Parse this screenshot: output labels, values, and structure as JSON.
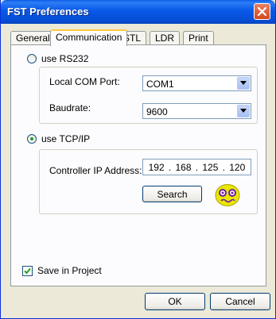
{
  "window": {
    "title": "FST Preferences"
  },
  "tabs": [
    {
      "label": "General"
    },
    {
      "label": "Communication",
      "active": true
    },
    {
      "label": "STL"
    },
    {
      "label": "LDR"
    },
    {
      "label": "Print"
    }
  ],
  "rs232": {
    "radio_label": "use RS232",
    "selected": false,
    "com_port_label": "Local COM Port:",
    "com_port_value": "COM1",
    "baudrate_label": "Baudrate:",
    "baudrate_value": "9600"
  },
  "tcpip": {
    "radio_label": "use TCP/IP",
    "selected": true,
    "ip_label": "Controller IP Address:",
    "ip": [
      "192",
      "168",
      "125",
      "120"
    ],
    "search_label": "Search",
    "status_icon": "smiley-status-icon"
  },
  "save_in_project": {
    "label": "Save in Project",
    "checked": true
  },
  "footer": {
    "ok_label": "OK",
    "cancel_label": "Cancel"
  },
  "colors": {
    "title_bar": "#0a5ce6",
    "dialog_bg": "#ece9d8",
    "smiley": "#e8e800"
  }
}
